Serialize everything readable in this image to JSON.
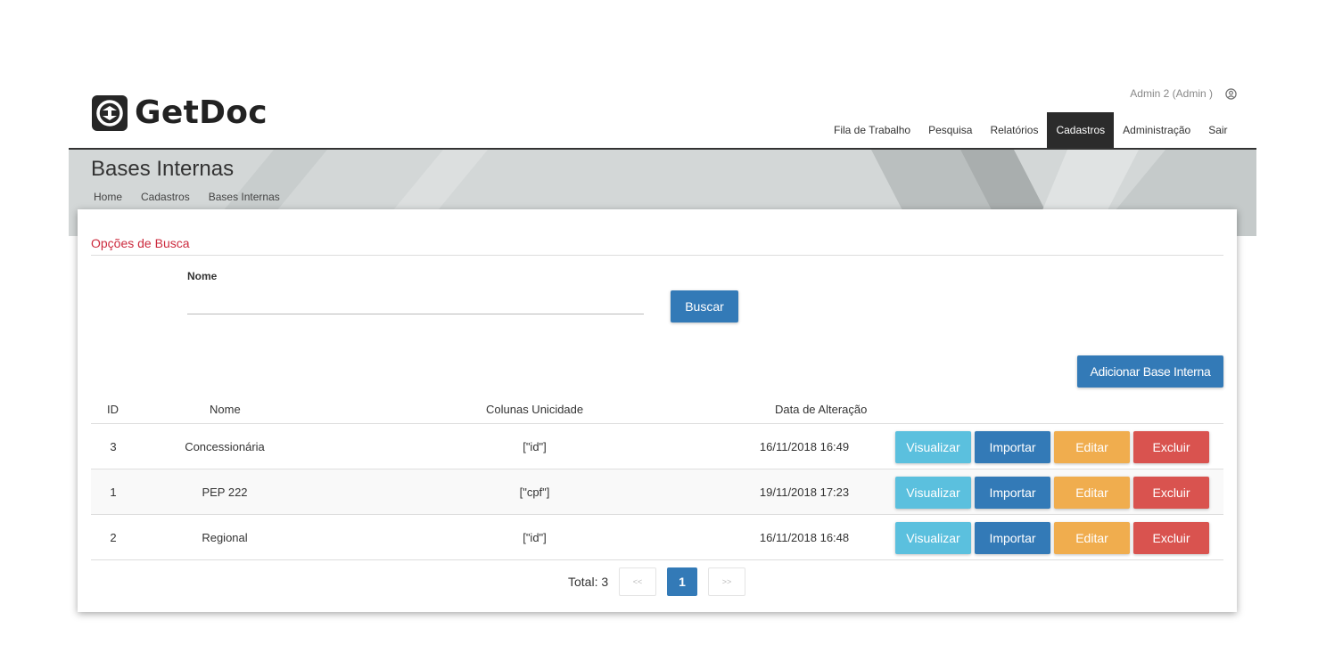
{
  "app": {
    "name": "GetDoc"
  },
  "user": {
    "label": "Admin 2 (Admin )"
  },
  "nav": [
    {
      "label": "Fila de Trabalho"
    },
    {
      "label": "Pesquisa"
    },
    {
      "label": "Relatórios"
    },
    {
      "label": "Cadastros",
      "active": true
    },
    {
      "label": "Administração"
    },
    {
      "label": "Sair"
    }
  ],
  "page": {
    "title": "Bases Internas",
    "breadcrumb": [
      "Home",
      "Cadastros",
      "Bases Internas"
    ]
  },
  "search": {
    "section_title": "Opções de Busca",
    "field_label": "Nome",
    "field_value": "",
    "button_label": "Buscar"
  },
  "add_button_label": "Adicionar Base Interna",
  "table": {
    "headers": [
      "ID",
      "Nome",
      "Colunas Unicidade",
      "Data de Alteração"
    ],
    "rows": [
      {
        "id": "3",
        "nome": "Concessionária",
        "colunas": "[\"id\"]",
        "data": "16/11/2018 16:49"
      },
      {
        "id": "1",
        "nome": "PEP 222",
        "colunas": "[\"cpf\"]",
        "data": "19/11/2018 17:23"
      },
      {
        "id": "2",
        "nome": "Regional",
        "colunas": "[\"id\"]",
        "data": "16/11/2018 16:48"
      }
    ],
    "actions": [
      "Visualizar",
      "Importar",
      "Editar",
      "Excluir"
    ]
  },
  "pagination": {
    "total_label": "Total: 3",
    "prev": "<<",
    "current": "1",
    "next": ">>"
  },
  "colors": {
    "primary": "#337ab7",
    "info": "#5bc0de",
    "warning": "#f0ad4e",
    "danger": "#d9534f",
    "section_title": "#cc2a3d",
    "nav_active": "#2b2b2b"
  }
}
